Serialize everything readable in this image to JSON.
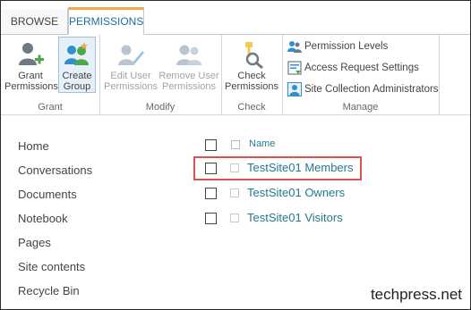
{
  "ribbon": {
    "tabs": [
      {
        "label": "BROWSE"
      },
      {
        "label": "PERMISSIONS"
      }
    ],
    "groups": {
      "grant": {
        "label": "Grant",
        "grant_permissions": {
          "line1": "Grant",
          "line2": "Permissions"
        },
        "create_group": {
          "line1": "Create",
          "line2": "Group"
        }
      },
      "modify": {
        "label": "Modify",
        "edit_user": {
          "line1": "Edit User",
          "line2": "Permissions"
        },
        "remove_user": {
          "line1": "Remove User",
          "line2": "Permissions"
        }
      },
      "check": {
        "label": "Check",
        "check_permissions": {
          "line1": "Check",
          "line2": "Permissions"
        }
      },
      "manage": {
        "label": "Manage",
        "items": [
          {
            "label": "Permission Levels"
          },
          {
            "label": "Access Request Settings"
          },
          {
            "label": "Site Collection Administrators"
          }
        ]
      }
    }
  },
  "nav": {
    "items": [
      {
        "label": "Home"
      },
      {
        "label": "Conversations"
      },
      {
        "label": "Documents"
      },
      {
        "label": "Notebook"
      },
      {
        "label": "Pages"
      },
      {
        "label": "Site contents"
      },
      {
        "label": "Recycle Bin"
      }
    ]
  },
  "list": {
    "column_name": "Name",
    "rows": [
      {
        "name": "TestSite01 Members"
      },
      {
        "name": "TestSite01 Owners"
      },
      {
        "name": "TestSite01 Visitors"
      }
    ]
  },
  "watermark": "techpress.net",
  "colors": {
    "accent_tab_top": "#f2a74b",
    "link": "#1f7b8e",
    "highlight_box": "#d9534f"
  }
}
